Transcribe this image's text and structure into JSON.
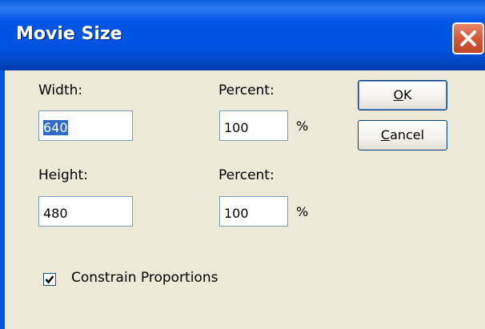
{
  "window": {
    "title": "Movie Size"
  },
  "labels": {
    "width": "Width:",
    "height": "Height:",
    "percent_width": "Percent:",
    "percent_height": "Percent:",
    "percent_symbol": "%"
  },
  "fields": {
    "width": "640",
    "height": "480",
    "width_percent": "100",
    "height_percent": "100"
  },
  "buttons": {
    "ok_mnemonic": "O",
    "ok_rest": "K",
    "cancel_mnemonic": "C",
    "cancel_rest": "ancel"
  },
  "checkbox": {
    "label": "Constrain Proportions",
    "checked": true
  },
  "colors": {
    "titlebar": "#0055e5",
    "dialog_bg": "#ece9d8",
    "close_button": "#d5563a",
    "selection": "#316ac5"
  },
  "icons": {
    "close": "close-icon",
    "check": "checkmark-icon"
  }
}
